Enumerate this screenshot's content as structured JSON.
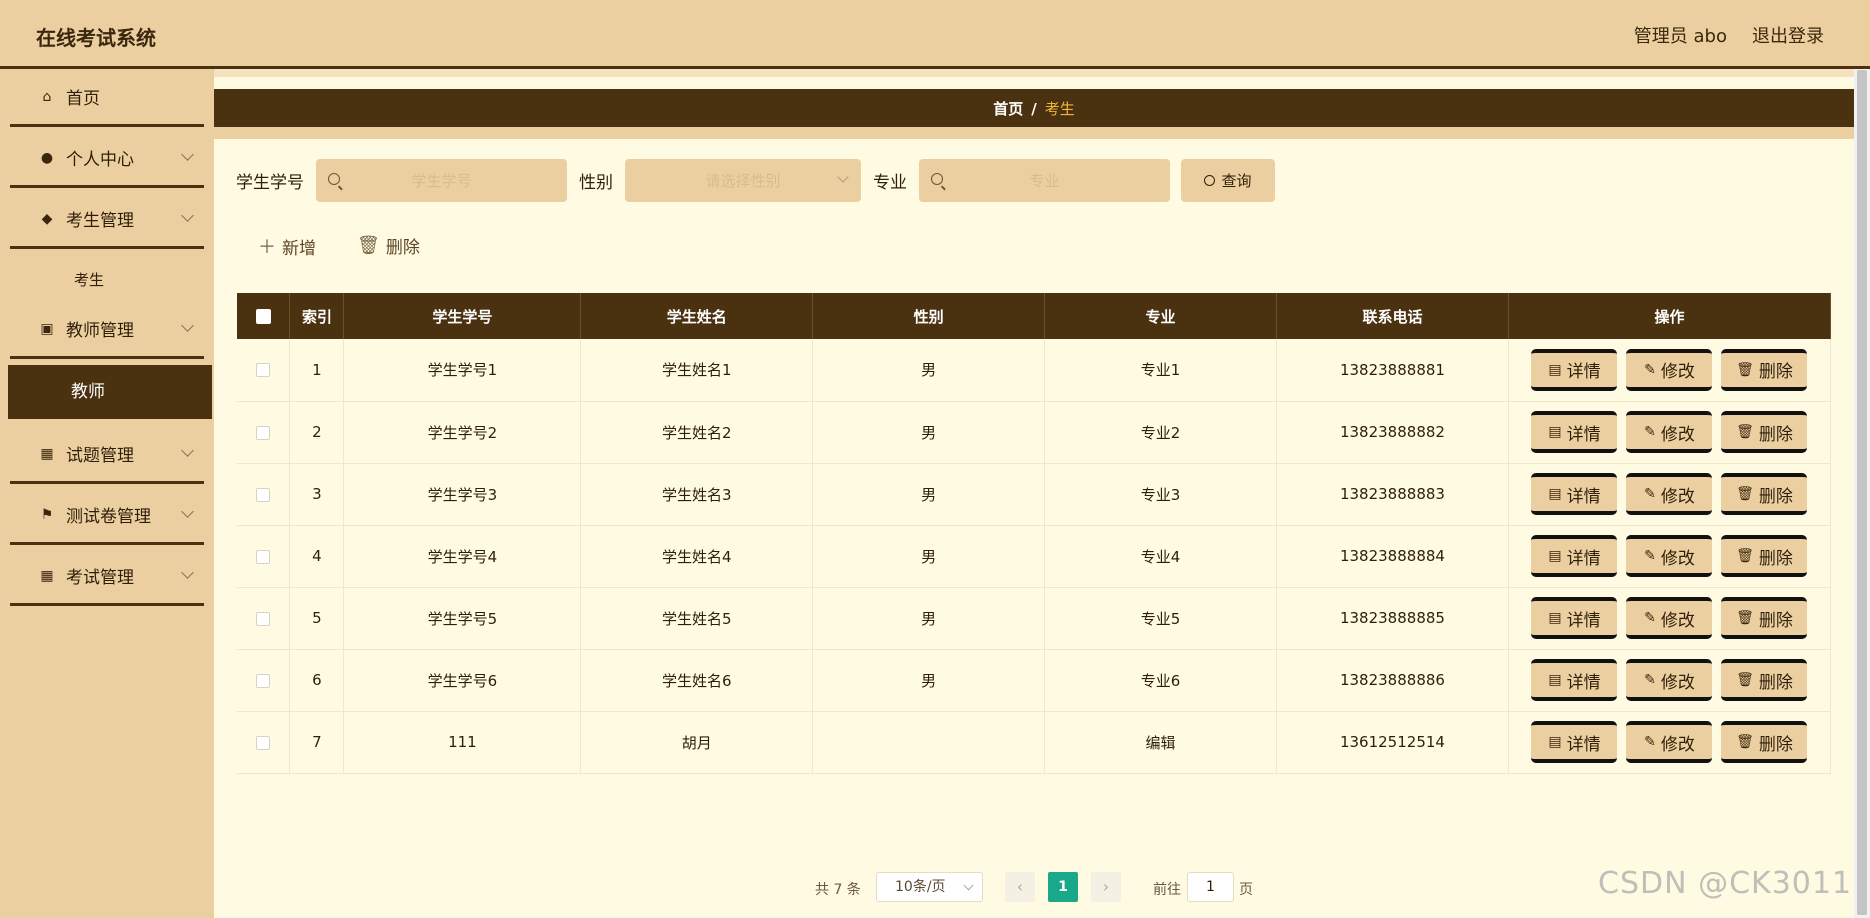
{
  "header": {
    "title": "在线考试系统",
    "user": "管理员 abo",
    "logout": "退出登录"
  },
  "sidebar": {
    "items": [
      {
        "label": "首页",
        "icon": "home-icon",
        "glyph": "⌂"
      },
      {
        "label": "个人中心",
        "icon": "person-icon",
        "glyph": "●"
      },
      {
        "label": "考生管理",
        "icon": "pin-icon",
        "glyph": "◆"
      },
      {
        "label": "教师管理",
        "icon": "clipboard-icon",
        "glyph": "▣"
      },
      {
        "label": "试题管理",
        "icon": "grid-icon",
        "glyph": "▦"
      },
      {
        "label": "测试卷管理",
        "icon": "flag-icon",
        "glyph": "⚑"
      },
      {
        "label": "考试管理",
        "icon": "grid-icon",
        "glyph": "▦"
      }
    ],
    "sub_kaosheng": "考生",
    "sub_jiaoshi": "教师"
  },
  "breadcrumb": {
    "home": "首页",
    "sep": "/",
    "current": "考生"
  },
  "search": {
    "label_id": "学生学号",
    "placeholder_id": "学生学号",
    "label_gender": "性别",
    "placeholder_gender": "请选择性别",
    "label_major": "专业",
    "placeholder_major": "专业",
    "query": "查询"
  },
  "actions": {
    "add": "新增",
    "delete": "删除"
  },
  "table": {
    "columns": [
      "索引",
      "学生学号",
      "学生姓名",
      "性别",
      "专业",
      "联系电话",
      "操作"
    ],
    "rows": [
      {
        "index": "1",
        "id": "学生学号1",
        "name": "学生姓名1",
        "gender": "男",
        "major": "专业1",
        "phone": "13823888881"
      },
      {
        "index": "2",
        "id": "学生学号2",
        "name": "学生姓名2",
        "gender": "男",
        "major": "专业2",
        "phone": "13823888882"
      },
      {
        "index": "3",
        "id": "学生学号3",
        "name": "学生姓名3",
        "gender": "男",
        "major": "专业3",
        "phone": "13823888883"
      },
      {
        "index": "4",
        "id": "学生学号4",
        "name": "学生姓名4",
        "gender": "男",
        "major": "专业4",
        "phone": "13823888884"
      },
      {
        "index": "5",
        "id": "学生学号5",
        "name": "学生姓名5",
        "gender": "男",
        "major": "专业5",
        "phone": "13823888885"
      },
      {
        "index": "6",
        "id": "学生学号6",
        "name": "学生姓名6",
        "gender": "男",
        "major": "专业6",
        "phone": "13823888886"
      },
      {
        "index": "7",
        "id": "111",
        "name": "胡月",
        "gender": "",
        "major": "编辑",
        "phone": "13612512514"
      }
    ],
    "op_detail": "详情",
    "op_edit": "修改",
    "op_delete": "删除"
  },
  "pagination": {
    "total": "共 7 条",
    "page_size": "10条/页",
    "current_page": "1",
    "goto_label": "前往",
    "goto_value": "1",
    "page_suffix": "页"
  },
  "watermark": "CSDN @CK3011",
  "colors": {
    "accent_dark": "#4a3110",
    "accent_light": "#eccfa1",
    "content_bg": "#fffbe2",
    "active_page": "#1aa88b"
  }
}
